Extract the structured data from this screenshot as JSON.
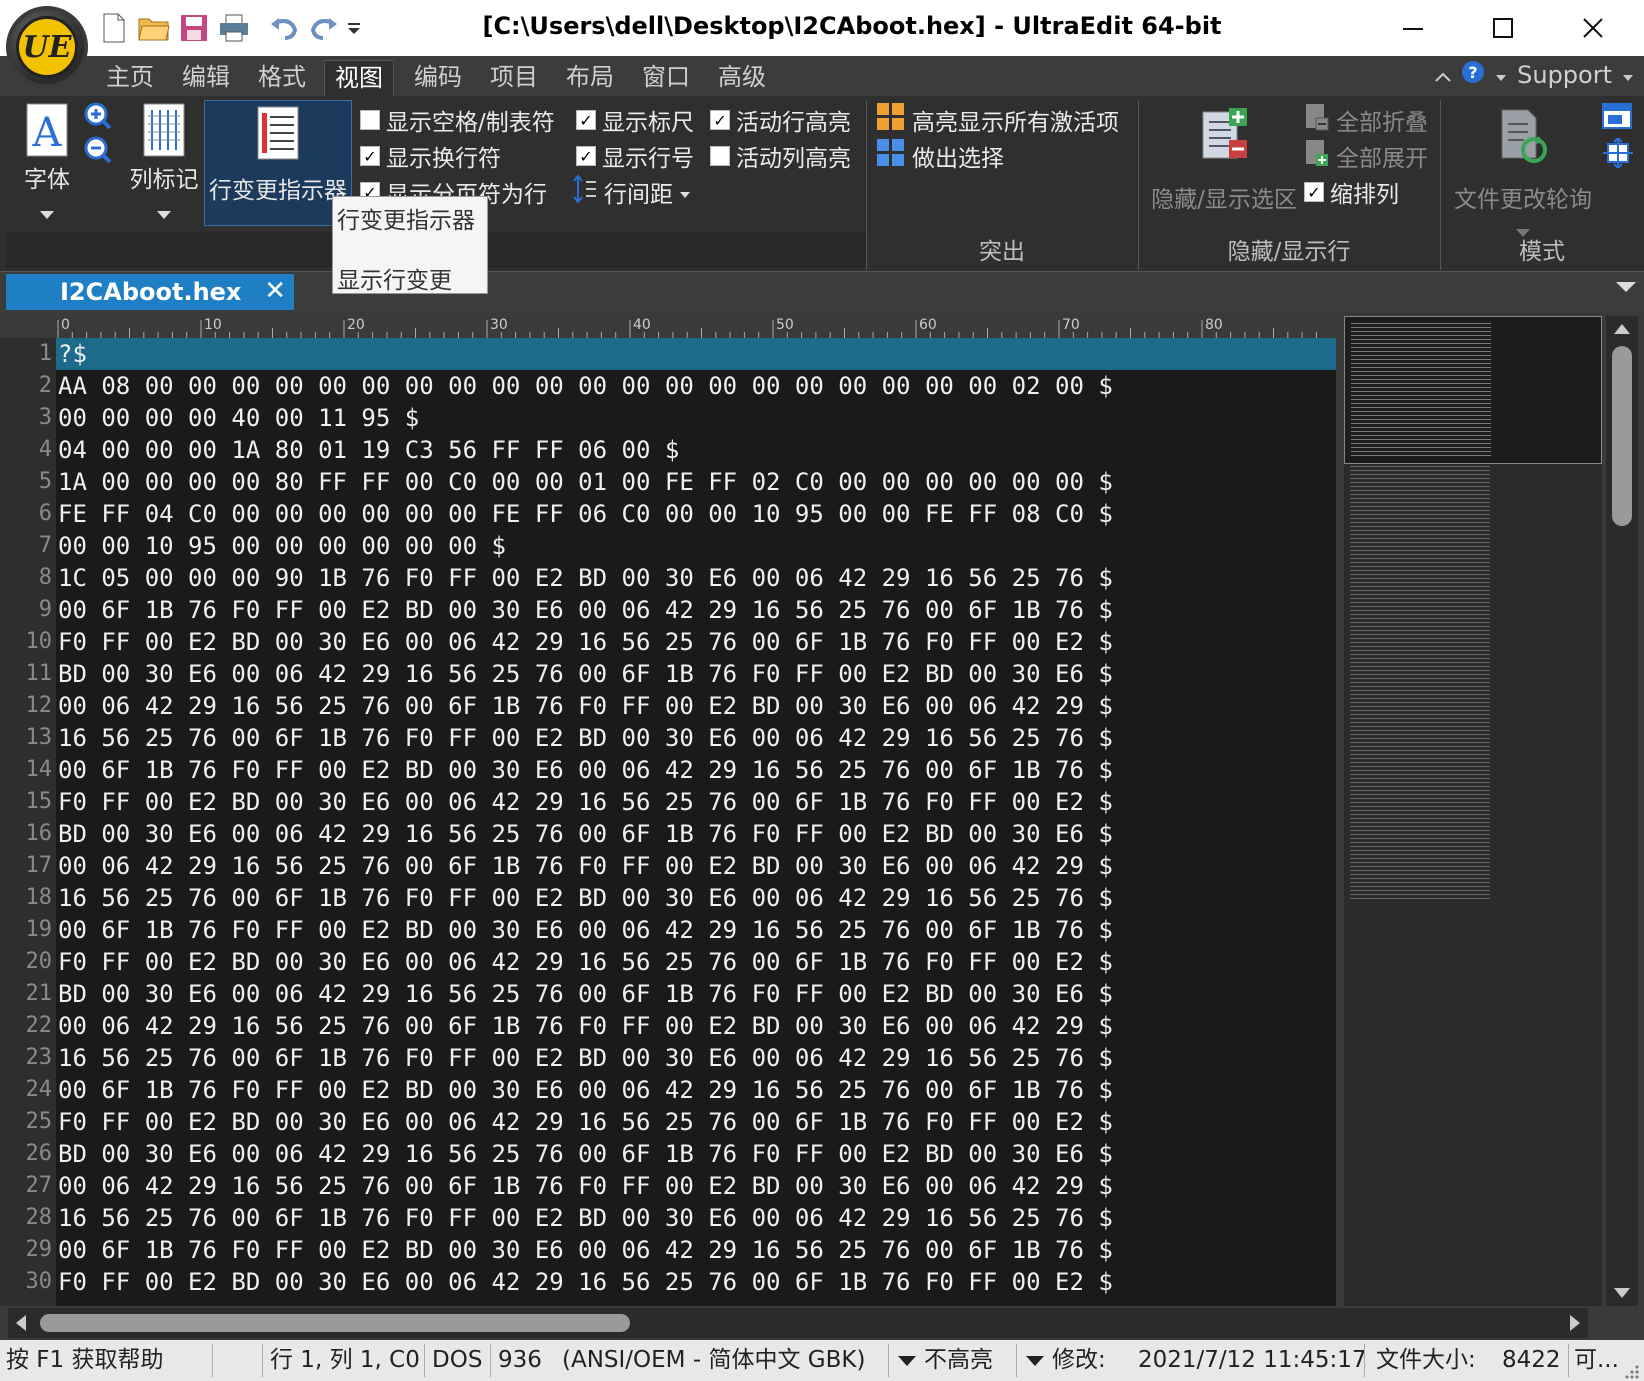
{
  "window": {
    "title": "[C:\\Users\\dell\\Desktop\\I2CAboot.hex] - UltraEdit 64-bit",
    "logo_text": "UE",
    "controls": [
      "—",
      "☐",
      "✕"
    ]
  },
  "menu": {
    "tabs": [
      "主页",
      "编辑",
      "格式",
      "视图",
      "编码",
      "项目",
      "布局",
      "窗口",
      "高级"
    ],
    "active_index": 3,
    "support": "Support"
  },
  "ribbon": {
    "font_label": "字体",
    "column_marker_label": "列标记",
    "line_change_label": "行变更指示器",
    "checks": {
      "show_spaces_tabs": {
        "label": "显示空格/制表符",
        "checked": false
      },
      "show_ruler": {
        "label": "显示标尺",
        "checked": true
      },
      "active_line_highlight": {
        "label": "活动行高亮",
        "checked": true
      },
      "show_line_breaks": {
        "label": "显示换行符",
        "checked": true
      },
      "show_line_numbers": {
        "label": "显示行号",
        "checked": true
      },
      "active_column_highlight": {
        "label": "活动列高亮",
        "checked": false
      },
      "show_page_breaks": {
        "label": "显示分页符为行",
        "checked": true
      },
      "indent_columns": {
        "label": "缩排列",
        "checked": true
      }
    },
    "line_spacing_label": "行间距",
    "highlight_all_active": "高亮显示所有激活项",
    "make_selection": "做出选择",
    "hide_show_selection": "隐藏/显示选区",
    "collapse_all": "全部折叠",
    "expand_all": "全部展开",
    "file_change_poll": "文件更改轮询",
    "groups": {
      "highlight": "突出",
      "hide_show_lines": "隐藏/显示行",
      "mode": "模式"
    }
  },
  "tooltip": {
    "title": "行变更指示器",
    "description": "显示行变更"
  },
  "document": {
    "tab_name": "I2CAboot.hex",
    "ruler_marks": [
      "0",
      "10",
      "20",
      "30",
      "40",
      "50",
      "60",
      "70",
      "80"
    ],
    "lines": [
      "?$",
      "AA 08 00 00 00 00 00 00 00 00 00 00 00 00 00 00 00 00 00 00 00 00 02 00 $",
      "00 00 00 00 40 00 11 95 $",
      "04 00 00 00 1A 80 01 19 C3 56 FF FF 06 00 $",
      "1A 00 00 00 00 80 FF FF 00 C0 00 00 01 00 FE FF 02 C0 00 00 00 00 00 00 $",
      "FE FF 04 C0 00 00 00 00 00 00 FE FF 06 C0 00 00 10 95 00 00 FE FF 08 C0 $",
      "00 00 10 95 00 00 00 00 00 00 $",
      "1C 05 00 00 00 90 1B 76 F0 FF 00 E2 BD 00 30 E6 00 06 42 29 16 56 25 76 $",
      "00 6F 1B 76 F0 FF 00 E2 BD 00 30 E6 00 06 42 29 16 56 25 76 00 6F 1B 76 $",
      "F0 FF 00 E2 BD 00 30 E6 00 06 42 29 16 56 25 76 00 6F 1B 76 F0 FF 00 E2 $",
      "BD 00 30 E6 00 06 42 29 16 56 25 76 00 6F 1B 76 F0 FF 00 E2 BD 00 30 E6 $",
      "00 06 42 29 16 56 25 76 00 6F 1B 76 F0 FF 00 E2 BD 00 30 E6 00 06 42 29 $",
      "16 56 25 76 00 6F 1B 76 F0 FF 00 E2 BD 00 30 E6 00 06 42 29 16 56 25 76 $",
      "00 6F 1B 76 F0 FF 00 E2 BD 00 30 E6 00 06 42 29 16 56 25 76 00 6F 1B 76 $",
      "F0 FF 00 E2 BD 00 30 E6 00 06 42 29 16 56 25 76 00 6F 1B 76 F0 FF 00 E2 $",
      "BD 00 30 E6 00 06 42 29 16 56 25 76 00 6F 1B 76 F0 FF 00 E2 BD 00 30 E6 $",
      "00 06 42 29 16 56 25 76 00 6F 1B 76 F0 FF 00 E2 BD 00 30 E6 00 06 42 29 $",
      "16 56 25 76 00 6F 1B 76 F0 FF 00 E2 BD 00 30 E6 00 06 42 29 16 56 25 76 $",
      "00 6F 1B 76 F0 FF 00 E2 BD 00 30 E6 00 06 42 29 16 56 25 76 00 6F 1B 76 $",
      "F0 FF 00 E2 BD 00 30 E6 00 06 42 29 16 56 25 76 00 6F 1B 76 F0 FF 00 E2 $",
      "BD 00 30 E6 00 06 42 29 16 56 25 76 00 6F 1B 76 F0 FF 00 E2 BD 00 30 E6 $",
      "00 06 42 29 16 56 25 76 00 6F 1B 76 F0 FF 00 E2 BD 00 30 E6 00 06 42 29 $",
      "16 56 25 76 00 6F 1B 76 F0 FF 00 E2 BD 00 30 E6 00 06 42 29 16 56 25 76 $",
      "00 6F 1B 76 F0 FF 00 E2 BD 00 30 E6 00 06 42 29 16 56 25 76 00 6F 1B 76 $",
      "F0 FF 00 E2 BD 00 30 E6 00 06 42 29 16 56 25 76 00 6F 1B 76 F0 FF 00 E2 $",
      "BD 00 30 E6 00 06 42 29 16 56 25 76 00 6F 1B 76 F0 FF 00 E2 BD 00 30 E6 $",
      "00 06 42 29 16 56 25 76 00 6F 1B 76 F0 FF 00 E2 BD 00 30 E6 00 06 42 29 $",
      "16 56 25 76 00 6F 1B 76 F0 FF 00 E2 BD 00 30 E6 00 06 42 29 16 56 25 76 $",
      "00 6F 1B 76 F0 FF 00 E2 BD 00 30 E6 00 06 42 29 16 56 25 76 00 6F 1B 76 $",
      "F0 FF 00 E2 BD 00 30 E6 00 06 42 29 16 56 25 76 00 6F 1B 76 F0 FF 00 E2 $"
    ]
  },
  "statusbar": {
    "help": "按 F1 获取帮助",
    "position": "行 1, 列 1, C0",
    "line_ending": "DOS",
    "codepage": "936",
    "encoding": "(ANSI/OEM - 简体中文 GBK)",
    "highlight": "不高亮",
    "modified_label": "修改:",
    "modified_value": "2021/7/12 11:45:17",
    "filesize_label": "文件大小:",
    "filesize_value": "8422",
    "mode": "可..."
  },
  "colors": {
    "accent_tab": "#1f7fc4",
    "active_line": "#1e6a8a",
    "editor_bg": "#1a1a1a",
    "ribbon_bg": "#2f2f2f"
  }
}
